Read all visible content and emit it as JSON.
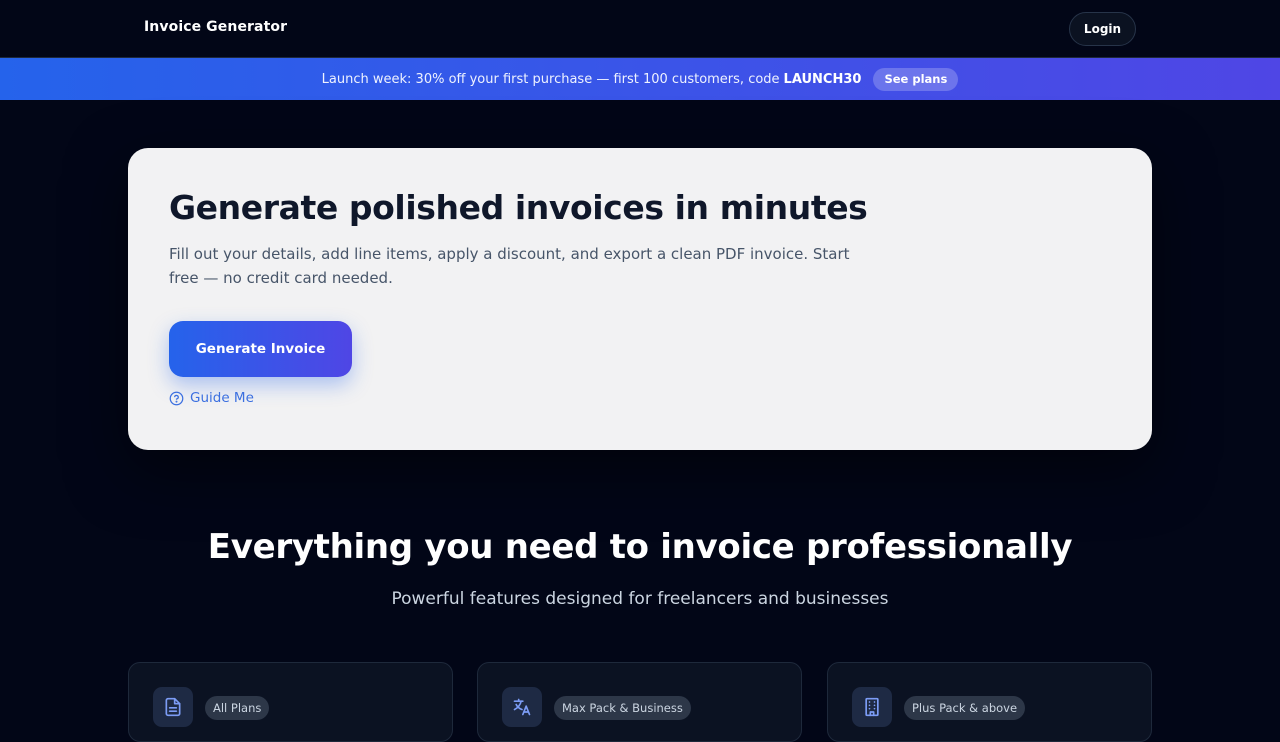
{
  "header": {
    "brand": "Invoice Generator",
    "login_label": "Login"
  },
  "promo": {
    "text": "Launch week: 30% off your first purchase — first 100 customers, code",
    "code": "LAUNCH30",
    "cta": "See plans"
  },
  "hero": {
    "title": "Generate polished invoices in minutes",
    "subtitle": "Fill out your details, add line items, apply a discount, and export a clean PDF invoice. Start free — no credit card needed.",
    "primary_cta": "Generate Invoice",
    "guide_label": "Guide Me"
  },
  "features": {
    "title": "Everything you need to invoice professionally",
    "subtitle": "Powerful features designed for freelancers and businesses",
    "cards": [
      {
        "icon": "document-icon",
        "badge": "All Plans"
      },
      {
        "icon": "translate-icon",
        "badge": "Max Pack & Business"
      },
      {
        "icon": "building-icon",
        "badge": "Plus Pack & above"
      }
    ]
  },
  "colors": {
    "background": "#020617",
    "accent_start": "#2563eb",
    "accent_end": "#4f46e5",
    "hero_card": "#f2f2f3",
    "link": "#3b6fe0"
  }
}
